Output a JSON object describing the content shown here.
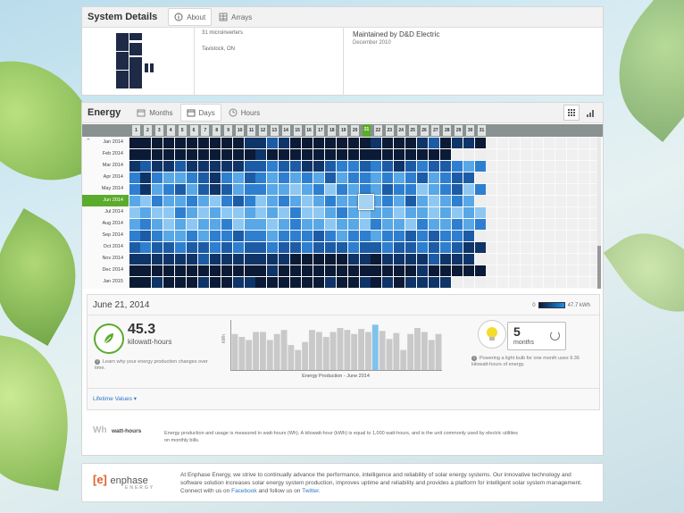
{
  "system": {
    "title": "System Details",
    "tabs": [
      {
        "label": "About",
        "icon": "info-icon"
      },
      {
        "label": "Arrays",
        "icon": "arrays-grid-icon"
      }
    ],
    "microinverters": "31 microinverters",
    "location": "Tavistock, ON",
    "maintainer": "Maintained by D&D Electric",
    "maint_date": "December 2010"
  },
  "energy": {
    "title": "Energy",
    "tabs": [
      {
        "label": "Months",
        "icon": "calendar-icon"
      },
      {
        "label": "Days",
        "icon": "calendar-23-icon"
      },
      {
        "label": "Hours",
        "icon": "clock-icon"
      }
    ],
    "view_icons": [
      "grid-view-icon",
      "bar-chart-icon"
    ],
    "days": [
      "1",
      "2",
      "3",
      "4",
      "5",
      "6",
      "7",
      "8",
      "9",
      "10",
      "11",
      "12",
      "13",
      "14",
      "15",
      "16",
      "17",
      "18",
      "19",
      "20",
      "21",
      "22",
      "23",
      "24",
      "25",
      "26",
      "27",
      "28",
      "29",
      "30",
      "31"
    ],
    "selected_day": "21",
    "months": [
      "Jan 2014",
      "Feb 2014",
      "Mar 2014",
      "Apr 2014",
      "May 2014",
      "Jun 2014",
      "Jul 2014",
      "Aug 2014",
      "Sep 2014",
      "Oct 2014",
      "Nov 2014",
      "Dec 2014",
      "Jan 2015"
    ],
    "selected_month": "Jun 2014",
    "days_in_month": [
      31,
      28,
      31,
      30,
      31,
      30,
      31,
      31,
      30,
      31,
      30,
      31,
      28
    ],
    "heat_levels": [
      [
        0,
        0,
        0,
        0,
        0,
        0,
        0,
        0,
        0,
        0,
        1,
        1,
        2,
        1,
        0,
        0,
        0,
        0,
        0,
        0,
        0,
        1,
        0,
        0,
        0,
        1,
        2,
        0,
        1,
        1,
        0
      ],
      [
        0,
        0,
        0,
        0,
        0,
        0,
        0,
        0,
        0,
        0,
        0,
        1,
        0,
        0,
        0,
        0,
        0,
        0,
        0,
        0,
        0,
        0,
        0,
        0,
        0,
        0,
        0,
        0
      ],
      [
        1,
        2,
        1,
        1,
        2,
        1,
        1,
        1,
        1,
        1,
        2,
        2,
        3,
        2,
        2,
        1,
        1,
        2,
        3,
        3,
        2,
        3,
        2,
        1,
        2,
        3,
        2,
        2,
        3,
        4,
        3
      ],
      [
        3,
        1,
        3,
        4,
        4,
        3,
        2,
        1,
        3,
        4,
        2,
        3,
        4,
        3,
        4,
        3,
        4,
        2,
        4,
        3,
        3,
        4,
        3,
        4,
        3,
        2,
        4,
        3,
        2,
        2
      ],
      [
        3,
        1,
        4,
        3,
        2,
        4,
        2,
        1,
        2,
        4,
        3,
        3,
        4,
        4,
        5,
        4,
        3,
        5,
        3,
        4,
        3,
        4,
        2,
        3,
        3,
        5,
        4,
        3,
        2,
        5,
        3
      ],
      [
        4,
        5,
        3,
        4,
        4,
        3,
        4,
        5,
        3,
        2,
        3,
        5,
        4,
        3,
        4,
        5,
        4,
        3,
        4,
        4,
        5,
        4,
        3,
        4,
        2,
        4,
        5,
        4,
        3,
        4
      ],
      [
        5,
        4,
        5,
        5,
        3,
        4,
        5,
        4,
        5,
        5,
        4,
        5,
        4,
        5,
        3,
        5,
        5,
        4,
        3,
        4,
        5,
        4,
        4,
        5,
        4,
        4,
        5,
        4,
        5,
        4,
        5
      ],
      [
        4,
        3,
        4,
        5,
        4,
        5,
        4,
        4,
        3,
        5,
        4,
        4,
        5,
        4,
        3,
        4,
        4,
        5,
        4,
        4,
        5,
        3,
        4,
        4,
        5,
        3,
        4,
        4,
        3,
        4,
        3
      ],
      [
        3,
        2,
        3,
        4,
        4,
        3,
        4,
        3,
        3,
        2,
        3,
        3,
        4,
        3,
        3,
        3,
        2,
        3,
        4,
        3,
        3,
        4,
        3,
        3,
        2,
        3,
        2,
        3,
        3,
        2
      ],
      [
        2,
        3,
        2,
        2,
        3,
        2,
        2,
        3,
        2,
        3,
        2,
        2,
        3,
        2,
        2,
        3,
        2,
        2,
        2,
        3,
        2,
        2,
        3,
        2,
        2,
        3,
        2,
        3,
        2,
        1,
        1
      ],
      [
        1,
        1,
        1,
        1,
        1,
        1,
        2,
        1,
        1,
        1,
        1,
        1,
        1,
        1,
        0,
        0,
        0,
        0,
        0,
        1,
        1,
        0,
        1,
        1,
        1,
        1,
        2,
        1,
        1,
        1
      ],
      [
        0,
        0,
        0,
        0,
        0,
        0,
        0,
        0,
        0,
        0,
        0,
        0,
        1,
        0,
        0,
        0,
        0,
        0,
        0,
        0,
        0,
        0,
        0,
        0,
        0,
        1,
        0,
        0,
        0,
        0,
        0
      ],
      [
        0,
        0,
        1,
        0,
        0,
        0,
        1,
        0,
        0,
        1,
        1,
        0,
        0,
        0,
        0,
        0,
        0,
        1,
        0,
        0,
        1,
        0,
        1,
        0,
        1,
        1,
        1,
        1
      ]
    ],
    "colors": [
      "#0b1a35",
      "#0f3468",
      "#1c5ca6",
      "#2e7fd0",
      "#58a7e6",
      "#8ec8f2"
    ],
    "detail": {
      "date": "June 21, 2014",
      "legend_min": "0",
      "legend_max": "47.7 kWh",
      "value": "45.3",
      "unit": "kilowatt-hours",
      "learn_text": "Learn why your energy production changes over time.",
      "chart_xlabel": "Energy Production - June 2014",
      "chart_ylabel": "kWh",
      "months_value": "5",
      "months_label": "months",
      "bulb_text": "Powering a light bulb for one month uses 9.36 kilowatt-hours of energy.",
      "lifetime": "Lifetime Values"
    },
    "wh": {
      "icon_text": "Wh",
      "title": "watt-hours",
      "text": "Energy production and usage is measured in watt-hours (Wh). A kilowatt-hour (kWh) is equal to 1,000 watt-hours, and is the unit commonly used by electric utilities on monthly bills."
    }
  },
  "chart_data": {
    "type": "bar",
    "xlabel": "Energy Production - June 2014",
    "ylabel": "kWh",
    "categories": [
      "1",
      "2",
      "3",
      "4",
      "5",
      "6",
      "7",
      "8",
      "9",
      "10",
      "11",
      "12",
      "13",
      "14",
      "15",
      "16",
      "17",
      "18",
      "19",
      "20",
      "21",
      "22",
      "23",
      "24",
      "25",
      "26",
      "27",
      "28",
      "29",
      "30"
    ],
    "values": [
      36,
      33,
      30,
      38,
      38,
      30,
      36,
      40,
      25,
      20,
      28,
      40,
      38,
      33,
      38,
      42,
      40,
      36,
      41,
      38,
      45.3,
      39,
      31,
      37,
      20,
      36,
      42,
      38,
      30,
      36
    ],
    "highlight_index": 20,
    "ylim": [
      0,
      50
    ]
  },
  "footer": {
    "logo_mark": "[e]",
    "logo_text": "enphase",
    "logo_sub": "ENERGY",
    "text": "At Enphase Energy, we strive to continually advance the performance, intelligence and reliability of solar energy systems. Our innovative technology and software solution increases solar energy system production, improves uptime and reliability and provides a platform for intelligent solar system management. Connect with us on ",
    "facebook": "Facebook",
    "mid": " and follow us on ",
    "twitter": "Twitter",
    "end": "."
  }
}
